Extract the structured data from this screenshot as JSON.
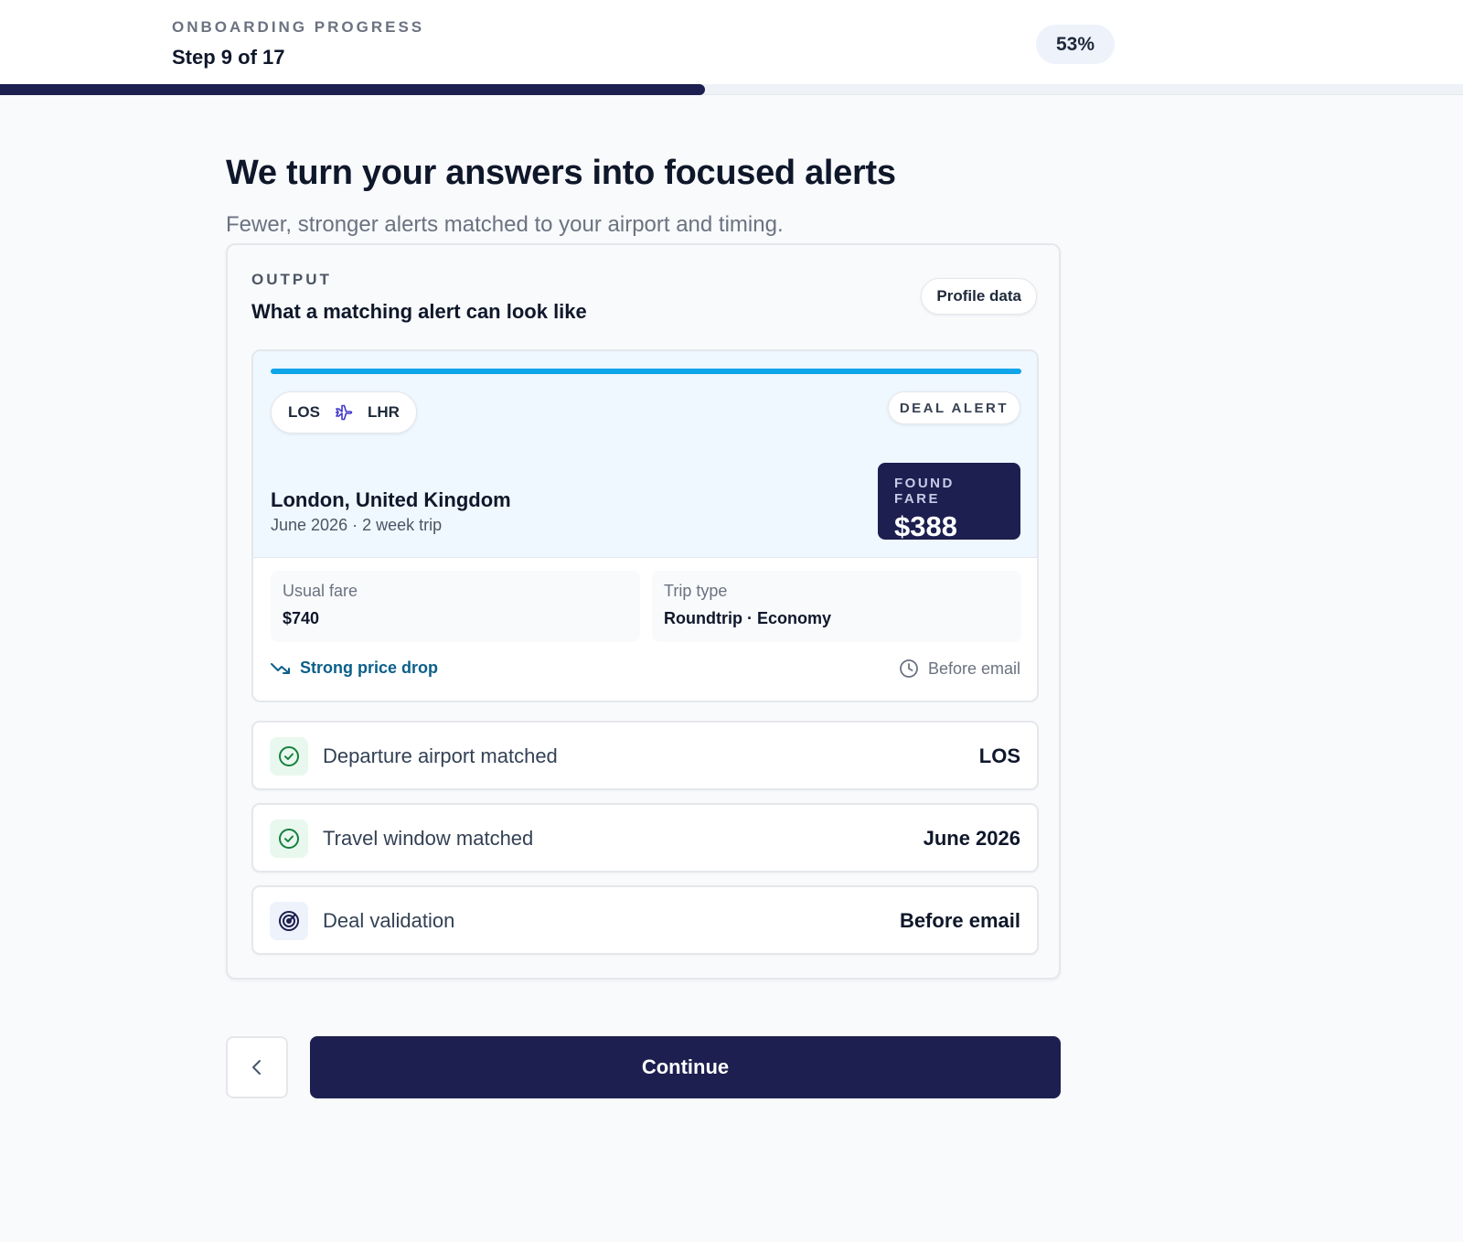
{
  "header": {
    "progress_label": "ONBOARDING PROGRESS",
    "step_text": "Step 9 of 17",
    "percent_text": "53%",
    "progress_value": 0.53
  },
  "main": {
    "title": "We turn your answers into focused alerts",
    "subtitle": "Fewer, stronger alerts matched to your airport and timing."
  },
  "output": {
    "eyebrow": "OUTPUT",
    "title": "What a matching alert can look like",
    "profile_pill": "Profile data",
    "deal": {
      "origin": "LOS",
      "destination_code": "LHR",
      "badge": "DEAL ALERT",
      "destination": "London, United Kingdom",
      "details": "June 2026 · 2 week trip",
      "fare_label": "FOUND FARE",
      "fare_value": "$388",
      "usual_fare_label": "Usual fare",
      "usual_fare_value": "$740",
      "trip_type_label": "Trip type",
      "trip_type_value": "Roundtrip · Economy",
      "signal": "Strong price drop",
      "timing": "Before email",
      "accent_color": "#0ea5e9"
    },
    "matches": [
      {
        "icon": "check-circle-icon",
        "label": "Departure airport matched",
        "value": "LOS"
      },
      {
        "icon": "check-circle-icon",
        "label": "Travel window matched",
        "value": "June 2026"
      },
      {
        "icon": "radar-icon",
        "label": "Deal validation",
        "value": "Before email"
      }
    ]
  },
  "actions": {
    "back_icon": "chevron-left-icon",
    "continue_label": "Continue"
  },
  "colors": {
    "brand": "#1c1f4f",
    "accent": "#0ea5e9",
    "success": "#15803d",
    "signal": "#0b5f8a"
  }
}
